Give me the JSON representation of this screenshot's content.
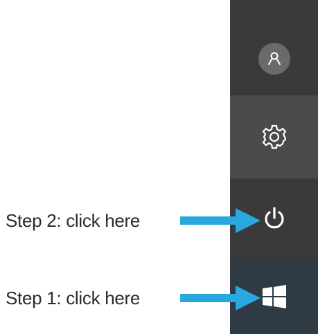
{
  "annotations": {
    "step2": "Step 2: click here",
    "step1": "Step 1: click here"
  },
  "start_menu": {
    "buttons": [
      {
        "name": "user-account",
        "icon": "user-icon"
      },
      {
        "name": "settings",
        "icon": "gear-icon"
      },
      {
        "name": "power",
        "icon": "power-icon"
      },
      {
        "name": "start",
        "icon": "windows-logo-icon"
      }
    ]
  },
  "colors": {
    "strip_background": "#3a3a3a",
    "settings_background": "#4b4b4b",
    "start_background": "#2f3b44",
    "arrow": "#29a8df",
    "icon": "#ffffff"
  }
}
